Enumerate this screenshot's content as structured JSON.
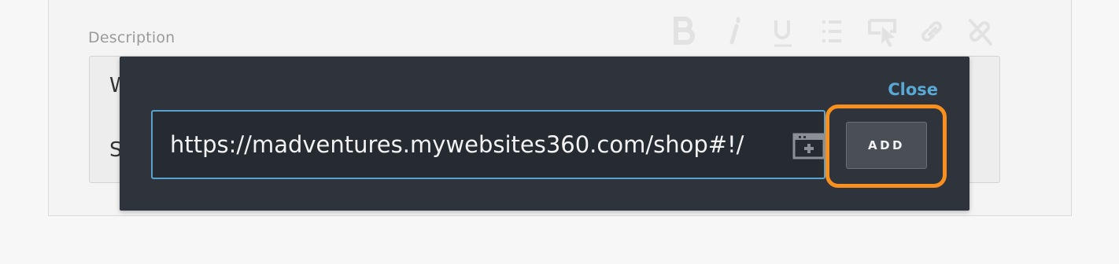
{
  "description": {
    "label": "Description",
    "editor_lines": [
      "W",
      "S"
    ]
  },
  "toolbar": {
    "icons": [
      "bold-icon",
      "italic-icon",
      "underline-icon",
      "list-icon",
      "select-icon",
      "link-icon",
      "unlink-icon"
    ]
  },
  "link_popover": {
    "close_label": "Close",
    "url_value": "https://madventures.mywebsites360.com/shop#!/",
    "add_label": "ADD",
    "highlight_color": "#f7901e",
    "accent_color": "#58a9d3"
  }
}
